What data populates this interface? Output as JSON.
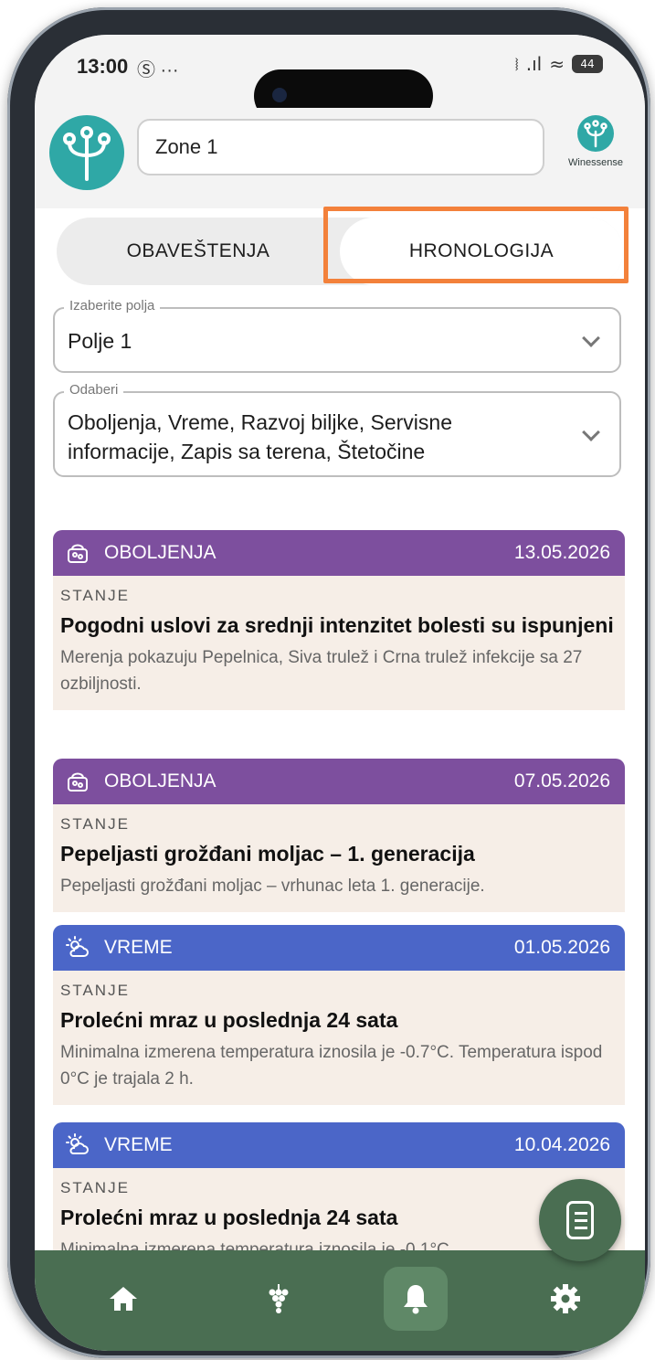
{
  "status_bar": {
    "time": "13:00",
    "time_extra": "Ⓢ ···",
    "mute_icon": "⧘",
    "signal_icon": ".ıl",
    "wifi_icon": "≈",
    "battery": "44"
  },
  "header": {
    "zone_value": "Zone 1",
    "brand_name": "Winessense",
    "logo_icon": "vine-logo-icon"
  },
  "tabs": [
    {
      "label": "OBAVEŠTENJA",
      "selected": false
    },
    {
      "label": "HRONOLOGIJA",
      "selected": true
    }
  ],
  "filters": {
    "field_select": {
      "legend": "Izaberite polja",
      "value": "Polje 1"
    },
    "category_select": {
      "legend": "Odaberi",
      "value": "Oboljenja, Vreme, Razvoj biljke, Servisne informacije, Zapis sa terena, Štetočine"
    }
  },
  "cards": [
    {
      "category": "OBOLJENJA",
      "date": "13.05.2026",
      "color": "#7d4f9e",
      "icon": "disease-icon",
      "state_label": "STANJE",
      "title": "Pogodni uslovi za srednji intenzitet bolesti su ispunjeni",
      "description": "Merenja pokazuju Pepelnica, Siva trulež i Crna trulež infekcije sa 27 ozbiljnosti."
    },
    {
      "category": "OBOLJENJA",
      "date": "07.05.2026",
      "color": "#7d4f9e",
      "icon": "disease-icon",
      "state_label": "STANJE",
      "title": "Pepeljasti grožđani moljac – 1. generacija",
      "description": "Pepeljasti grožđani moljac – vrhunac leta 1. generacije."
    },
    {
      "category": "VREME",
      "date": "01.05.2026",
      "color": "#4b66c8",
      "icon": "weather-icon",
      "state_label": "STANJE",
      "title": "Prolećni mraz u poslednja 24 sata",
      "description": "Minimalna izmerena temperatura iznosila je -0.7°C. Temperatura ispod 0°C je trajala 2 h."
    },
    {
      "category": "VREME",
      "date": "10.04.2026",
      "color": "#4b66c8",
      "icon": "weather-icon",
      "state_label": "STANJE",
      "title": "Prolećni mraz u poslednja 24 sata",
      "description": "Minimalna izmerena temperatura iznosila je -0.1°C."
    }
  ],
  "fab": {
    "icon": "document-icon"
  },
  "bottom_nav": [
    {
      "icon": "home-icon",
      "active": false
    },
    {
      "icon": "grape-icon",
      "active": false
    },
    {
      "icon": "bell-icon",
      "active": true
    },
    {
      "icon": "gear-icon",
      "active": false
    }
  ],
  "colors": {
    "accent_green": "#4a6e52",
    "highlight_orange": "#f3813b",
    "logo_teal": "#2fa8a6"
  }
}
